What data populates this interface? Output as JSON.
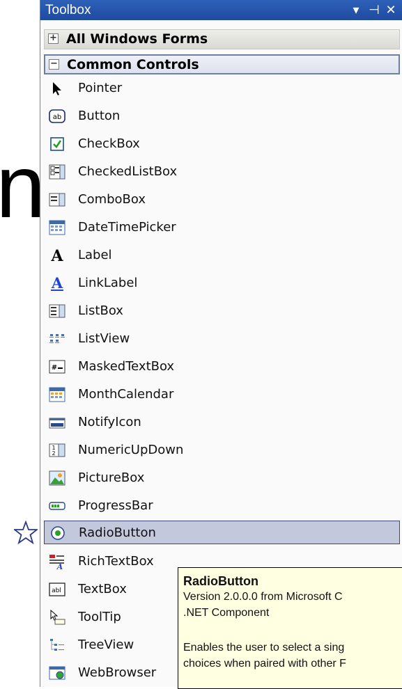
{
  "page": {
    "left_glyph": "n"
  },
  "toolbox": {
    "title": "Toolbox",
    "title_buttons": [
      {
        "name": "dropdown-arrow-icon",
        "glyph": "▾"
      },
      {
        "name": "pin-icon",
        "glyph": "⊣"
      },
      {
        "name": "close-icon",
        "glyph": "✕"
      }
    ],
    "groups": [
      {
        "label": "All Windows Forms",
        "expanded": false,
        "sign": "+"
      },
      {
        "label": "Common Controls",
        "expanded": true,
        "sign": "−"
      }
    ],
    "items": [
      {
        "label": "Pointer",
        "icon": "pointer-icon"
      },
      {
        "label": "Button",
        "icon": "button-icon"
      },
      {
        "label": "CheckBox",
        "icon": "checkbox-icon"
      },
      {
        "label": "CheckedListBox",
        "icon": "checkedlistbox-icon"
      },
      {
        "label": "ComboBox",
        "icon": "combobox-icon"
      },
      {
        "label": "DateTimePicker",
        "icon": "datetimepicker-icon"
      },
      {
        "label": "Label",
        "icon": "label-icon"
      },
      {
        "label": "LinkLabel",
        "icon": "linklabel-icon"
      },
      {
        "label": "ListBox",
        "icon": "listbox-icon"
      },
      {
        "label": "ListView",
        "icon": "listview-icon"
      },
      {
        "label": "MaskedTextBox",
        "icon": "maskedtextbox-icon"
      },
      {
        "label": "MonthCalendar",
        "icon": "monthcalendar-icon"
      },
      {
        "label": "NotifyIcon",
        "icon": "notifyicon-icon"
      },
      {
        "label": "NumericUpDown",
        "icon": "numericupdown-icon"
      },
      {
        "label": "PictureBox",
        "icon": "picturebox-icon"
      },
      {
        "label": "ProgressBar",
        "icon": "progressbar-icon"
      },
      {
        "label": "RadioButton",
        "icon": "radiobutton-icon",
        "selected": true
      },
      {
        "label": "RichTextBox",
        "icon": "richtextbox-icon"
      },
      {
        "label": "TextBox",
        "icon": "textbox-icon"
      },
      {
        "label": "ToolTip",
        "icon": "tooltip-icon"
      },
      {
        "label": "TreeView",
        "icon": "treeview-icon"
      },
      {
        "label": "WebBrowser",
        "icon": "webbrowser-icon"
      }
    ]
  },
  "tooltip": {
    "title": "RadioButton",
    "line1": "Version 2.0.0.0 from Microsoft C",
    "line2": ".NET Component",
    "line3": "Enables the user to select a sing",
    "line4": "choices when paired with other F"
  },
  "colors": {
    "titlebar": "#2d60b8",
    "selected_bg": "#c4c8dc",
    "tooltip_bg": "#ffffe1"
  }
}
